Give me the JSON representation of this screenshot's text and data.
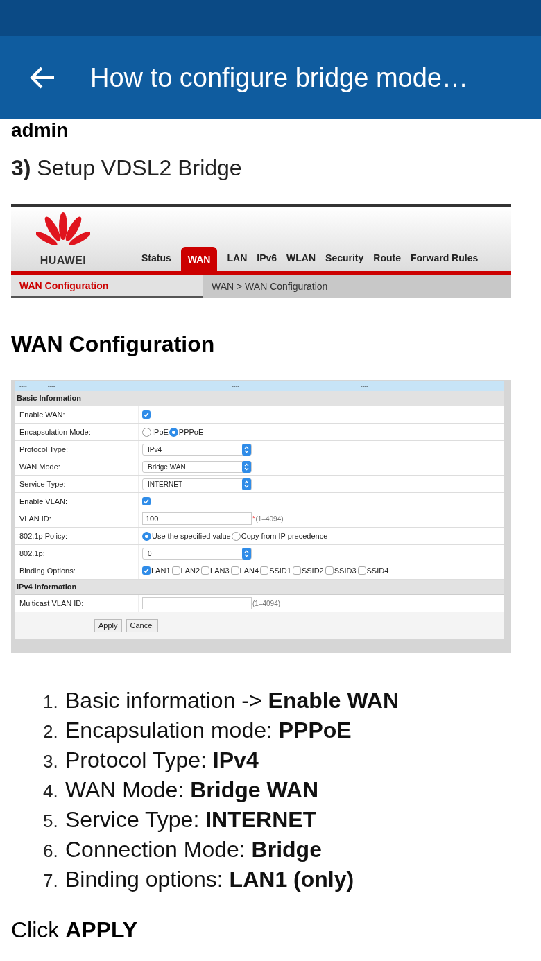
{
  "app_bar": {
    "title": "How to configure bridge mode…"
  },
  "cut_text": "admin",
  "step_heading": "**3)** Setup VDSL2 Bridge",
  "router_header": {
    "brand": "HUAWEI",
    "tabs": [
      {
        "label": "Status",
        "selected": false
      },
      {
        "label": "WAN",
        "selected": true
      },
      {
        "label": "LAN",
        "selected": false
      },
      {
        "label": "IPv6",
        "selected": false
      },
      {
        "label": "WLAN",
        "selected": false
      },
      {
        "label": "Security",
        "selected": false
      },
      {
        "label": "Route",
        "selected": false
      },
      {
        "label": "Forward Rules",
        "selected": false
      }
    ],
    "side_item": "WAN Configuration",
    "breadcrumb": "WAN > WAN Configuration"
  },
  "section_heading": "WAN Configuration",
  "form": {
    "header_cells": [
      "----",
      "----",
      "----",
      "----"
    ],
    "sections": [
      {
        "title": "Basic Information",
        "rows": [
          {
            "label": "Enable WAN:",
            "kind": "checkbox",
            "checked": true
          },
          {
            "label": "Encapsulation Mode:",
            "kind": "radio",
            "options": [
              {
                "label": "IPoE",
                "selected": false
              },
              {
                "label": "PPPoE",
                "selected": true
              }
            ]
          },
          {
            "label": "Protocol Type:",
            "kind": "select",
            "value": "IPv4"
          },
          {
            "label": "WAN Mode:",
            "kind": "select",
            "value": "Bridge WAN"
          },
          {
            "label": "Service Type:",
            "kind": "select",
            "value": "INTERNET"
          },
          {
            "label": "Enable VLAN:",
            "kind": "checkbox",
            "checked": true
          },
          {
            "label": "VLAN ID:",
            "kind": "input",
            "value": "100",
            "required_mark": "*",
            "hint": "(1–4094)"
          },
          {
            "label": "802.1p Policy:",
            "kind": "radio",
            "options": [
              {
                "label": "Use the specified value",
                "selected": true
              },
              {
                "label": "Copy from IP precedence",
                "selected": false
              }
            ]
          },
          {
            "label": "802.1p:",
            "kind": "select",
            "value": "0"
          },
          {
            "label": "Binding Options:",
            "kind": "checks",
            "options": [
              {
                "label": "LAN1",
                "checked": true
              },
              {
                "label": "LAN2",
                "checked": false
              },
              {
                "label": "LAN3",
                "checked": false
              },
              {
                "label": "LAN4",
                "checked": false
              },
              {
                "label": "SSID1",
                "checked": false
              },
              {
                "label": "SSID2",
                "checked": false
              },
              {
                "label": "SSID3",
                "checked": false
              },
              {
                "label": "SSID4",
                "checked": false
              }
            ]
          }
        ]
      },
      {
        "title": "IPv4 Information",
        "rows": [
          {
            "label": "Multicast VLAN ID:",
            "kind": "input",
            "hint": "(1–4094)"
          }
        ]
      }
    ],
    "buttons": [
      "Apply",
      "Cancel"
    ]
  },
  "steps": [
    {
      "number": "1.",
      "text": "Basic information -> **Enable WAN**"
    },
    {
      "number": "2.",
      "text": "Encapsulation mode: **PPPoE**"
    },
    {
      "number": "3.",
      "text": "Protocol Type: **IPv4**"
    },
    {
      "number": "4.",
      "text": "WAN Mode: **Bridge WAN**"
    },
    {
      "number": "5.",
      "text": "Service Type: **INTERNET**"
    },
    {
      "number": "6.",
      "text": "Connection Mode: **Bridge**"
    },
    {
      "number": "7.",
      "text": "Binding options: **LAN1 (only)**"
    }
  ],
  "footer": "Click **APPLY**"
}
